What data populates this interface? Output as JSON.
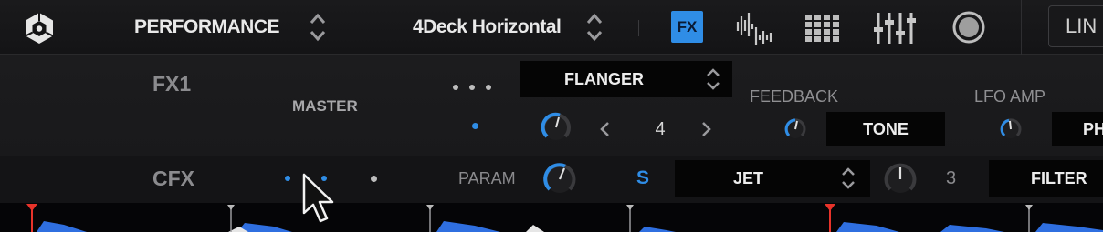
{
  "toolbar": {
    "mode_select": "PERFORMANCE",
    "layout_select": "4Deck Horizontal",
    "fx_button": "FX",
    "line_button": "LIN"
  },
  "fx1": {
    "label": "FX1",
    "master_label": "MASTER",
    "effect_name": "FLANGER",
    "beat_value": "4",
    "feedback_label": "FEEDBACK",
    "lfo_amp_label": "LFO AMP",
    "tone_label": "TONE",
    "ph_label": "PH"
  },
  "cfx": {
    "label": "CFX",
    "param_label": "PARAM",
    "s_label": "S",
    "effect_name": "JET",
    "value": "3",
    "filter_label": "FILTER"
  },
  "colors": {
    "accent": "#2f8de6",
    "background": "#141416",
    "marker_red": "#e8332a"
  }
}
